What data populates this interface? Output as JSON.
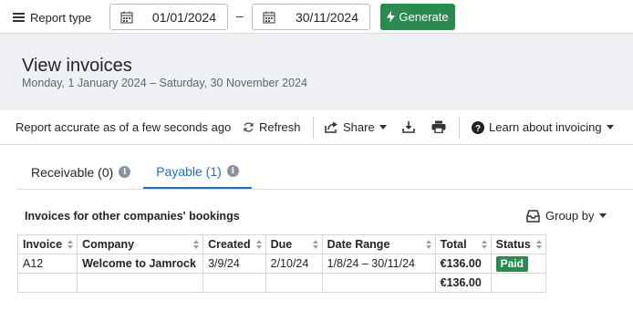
{
  "toolbar": {
    "report_type_label": "Report type",
    "start_date": "01/01/2024",
    "date_separator": "–",
    "end_date": "30/11/2024",
    "generate_label": "Generate"
  },
  "header": {
    "title": "View invoices",
    "subtitle": "Monday, 1 January 2024 – Saturday, 30 November 2024"
  },
  "actions": {
    "accuracy_text": "Report accurate as of a few seconds ago",
    "refresh_label": "Refresh",
    "share_label": "Share",
    "learn_label": "Learn about invoicing"
  },
  "tabs": [
    {
      "label": "Receivable (0)",
      "active": false
    },
    {
      "label": "Payable (1)",
      "active": true
    }
  ],
  "table": {
    "heading": "Invoices for other companies' bookings",
    "group_by_label": "Group by",
    "columns": [
      "Invoice",
      "Company",
      "Created",
      "Due",
      "Date Range",
      "Total",
      "Status"
    ],
    "rows": [
      {
        "invoice": "A12",
        "company": "Welcome to Jamrock",
        "created": "3/9/24",
        "due": "2/10/24",
        "date_range": "1/8/24 – 30/11/24",
        "total": "€136.00",
        "status": "Paid"
      }
    ],
    "footer_total": "€136.00"
  },
  "colors": {
    "accent": "#1f6fc5",
    "generate_bg": "#2a8a4f",
    "paid_bg": "#2a8a4f",
    "header_bg": "#eef0f3"
  }
}
